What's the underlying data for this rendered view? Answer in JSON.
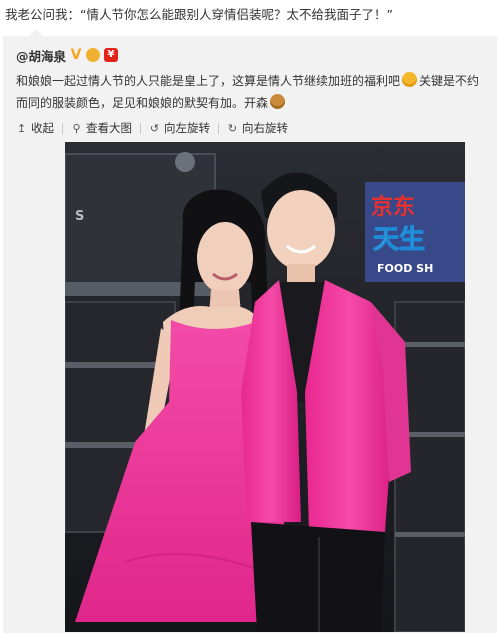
{
  "post": {
    "repost_text": "我老公问我：“情人节你怎么能跟别人穿情侣装呢？太不给我面子了！”"
  },
  "original": {
    "author": "@胡海泉",
    "badges": {
      "verified": "V",
      "red": "¥"
    },
    "text_part1": "和娘娘一起过情人节的人只能是皇上了，这算是情人节继续加班的福利吧",
    "text_part2": "关键是不约而同的服装颜色，足见和娘娘的默契有加。开森",
    "emoticon_1": "grin-emoticon",
    "emoticon_2": "monkey-emoticon"
  },
  "actions": {
    "collapse": "收起",
    "view_large": "查看大图",
    "rotate_left": "向左旋转",
    "rotate_right": "向右旋转"
  },
  "photo": {
    "sign_top": "京东",
    "sign_mid": "天生",
    "sign_bottom": "FOOD SH",
    "box_text": "S"
  },
  "colors": {
    "pink": "#f0329a",
    "backdrop": "#1b1d21"
  }
}
